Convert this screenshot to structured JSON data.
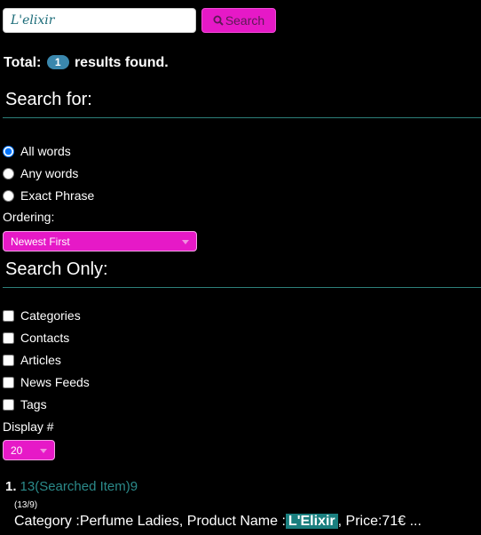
{
  "search": {
    "value": "L'elixir",
    "button_label": "Search"
  },
  "total": {
    "prefix": "Total:",
    "count": "1",
    "suffix": "results found."
  },
  "search_for": {
    "heading": "Search for:",
    "options": [
      {
        "label": "All words",
        "checked": true
      },
      {
        "label": "Any words",
        "checked": false
      },
      {
        "label": "Exact Phrase",
        "checked": false
      }
    ]
  },
  "ordering": {
    "label": "Ordering:",
    "selected": "Newest First"
  },
  "search_only": {
    "heading": "Search Only:",
    "options": [
      "Categories",
      "Contacts",
      "Articles",
      "News Feeds",
      "Tags"
    ]
  },
  "display": {
    "label": "Display #",
    "selected": "20"
  },
  "results": [
    {
      "number": "1.",
      "title": "13(Searched Item)9",
      "date": "(13/9)",
      "text_before": "Category :Perfume Ladies, Product Name :",
      "highlight": "L'Elixir",
      "text_after": ", Price:71€ ..."
    }
  ],
  "colors": {
    "accent": "#e619c7",
    "link": "#2b8a8a",
    "highlight_bg": "#1a7f7f",
    "badge": "#3a87ad"
  }
}
